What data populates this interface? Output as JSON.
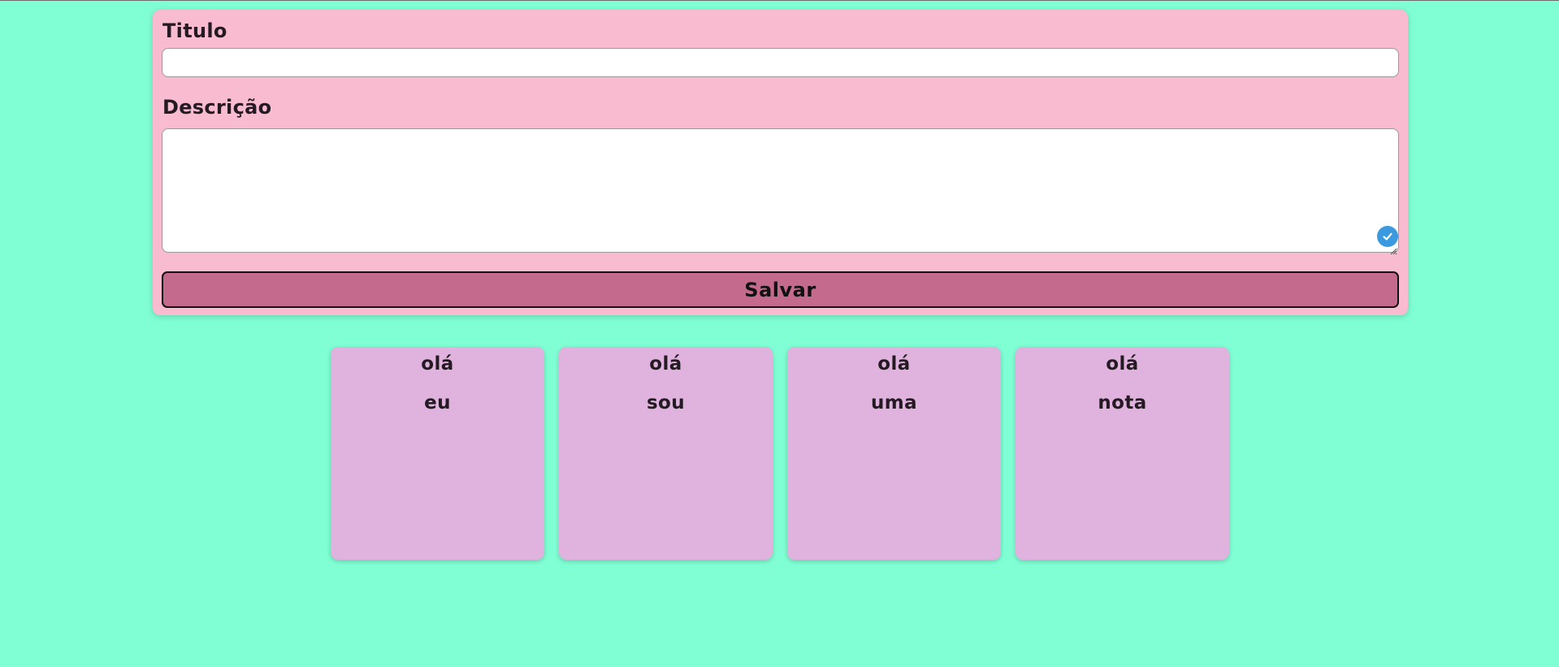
{
  "form": {
    "title_label": "Titulo",
    "title_value": "",
    "description_label": "Descrição",
    "description_value": "",
    "save_label": "Salvar"
  },
  "notes": [
    {
      "title": "olá",
      "description": "eu"
    },
    {
      "title": "olá",
      "description": "sou"
    },
    {
      "title": "olá",
      "description": "uma"
    },
    {
      "title": "olá",
      "description": "nota"
    }
  ],
  "colors": {
    "background": "#80ffd4",
    "form_card": "#f8bbd0",
    "save_button": "#c46a8c",
    "note_card": "#dfb3de",
    "check_badge": "#3b99e0"
  },
  "icons": {
    "textarea_badge": "check-circle-icon",
    "textarea_resize": "resize-handle-icon"
  }
}
